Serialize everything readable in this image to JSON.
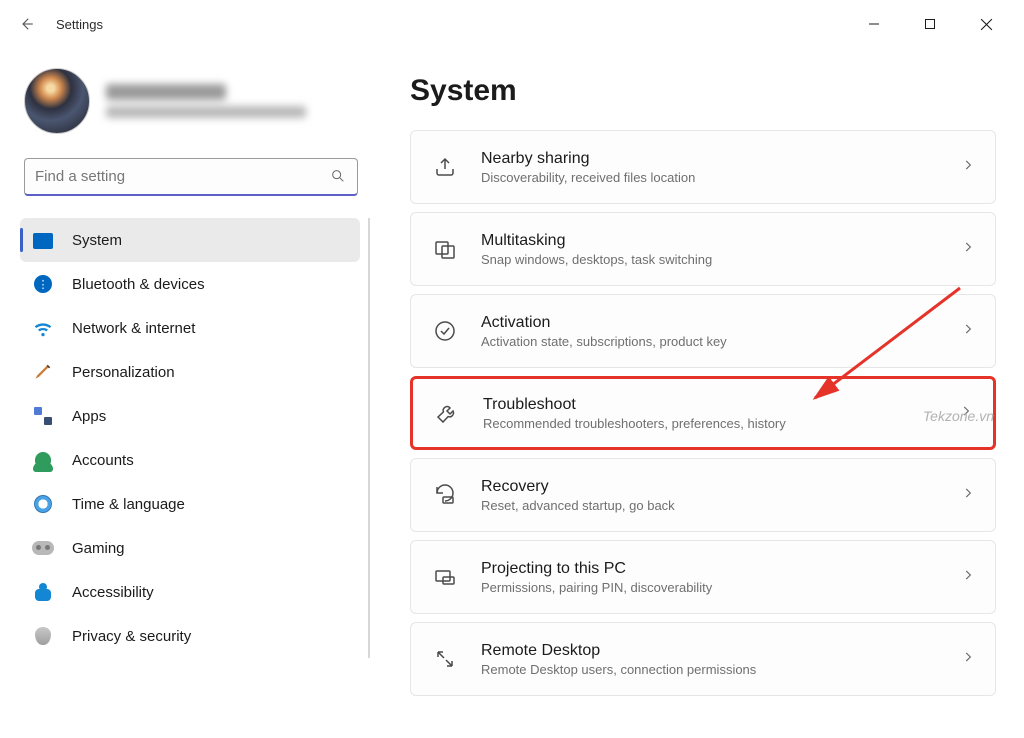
{
  "window": {
    "title": "Settings"
  },
  "profile": {
    "name": "User Name",
    "email": "useremail@example.com"
  },
  "search": {
    "placeholder": "Find a setting"
  },
  "sidebar": {
    "items": [
      {
        "id": "system",
        "label": "System",
        "active": true
      },
      {
        "id": "bluetooth",
        "label": "Bluetooth & devices",
        "active": false
      },
      {
        "id": "network",
        "label": "Network & internet",
        "active": false
      },
      {
        "id": "personalization",
        "label": "Personalization",
        "active": false
      },
      {
        "id": "apps",
        "label": "Apps",
        "active": false
      },
      {
        "id": "accounts",
        "label": "Accounts",
        "active": false
      },
      {
        "id": "time",
        "label": "Time & language",
        "active": false
      },
      {
        "id": "gaming",
        "label": "Gaming",
        "active": false
      },
      {
        "id": "accessibility",
        "label": "Accessibility",
        "active": false
      },
      {
        "id": "privacy",
        "label": "Privacy & security",
        "active": false
      }
    ]
  },
  "main": {
    "page_title": "System",
    "cards": [
      {
        "id": "nearby",
        "title": "Nearby sharing",
        "desc": "Discoverability, received files location",
        "highlight": false
      },
      {
        "id": "multitasking",
        "title": "Multitasking",
        "desc": "Snap windows, desktops, task switching",
        "highlight": false
      },
      {
        "id": "activation",
        "title": "Activation",
        "desc": "Activation state, subscriptions, product key",
        "highlight": false
      },
      {
        "id": "troubleshoot",
        "title": "Troubleshoot",
        "desc": "Recommended troubleshooters, preferences, history",
        "highlight": true
      },
      {
        "id": "recovery",
        "title": "Recovery",
        "desc": "Reset, advanced startup, go back",
        "highlight": false
      },
      {
        "id": "projecting",
        "title": "Projecting to this PC",
        "desc": "Permissions, pairing PIN, discoverability",
        "highlight": false
      },
      {
        "id": "remote",
        "title": "Remote Desktop",
        "desc": "Remote Desktop users, connection permissions",
        "highlight": false
      }
    ]
  },
  "watermark": "Tekzone.vn"
}
